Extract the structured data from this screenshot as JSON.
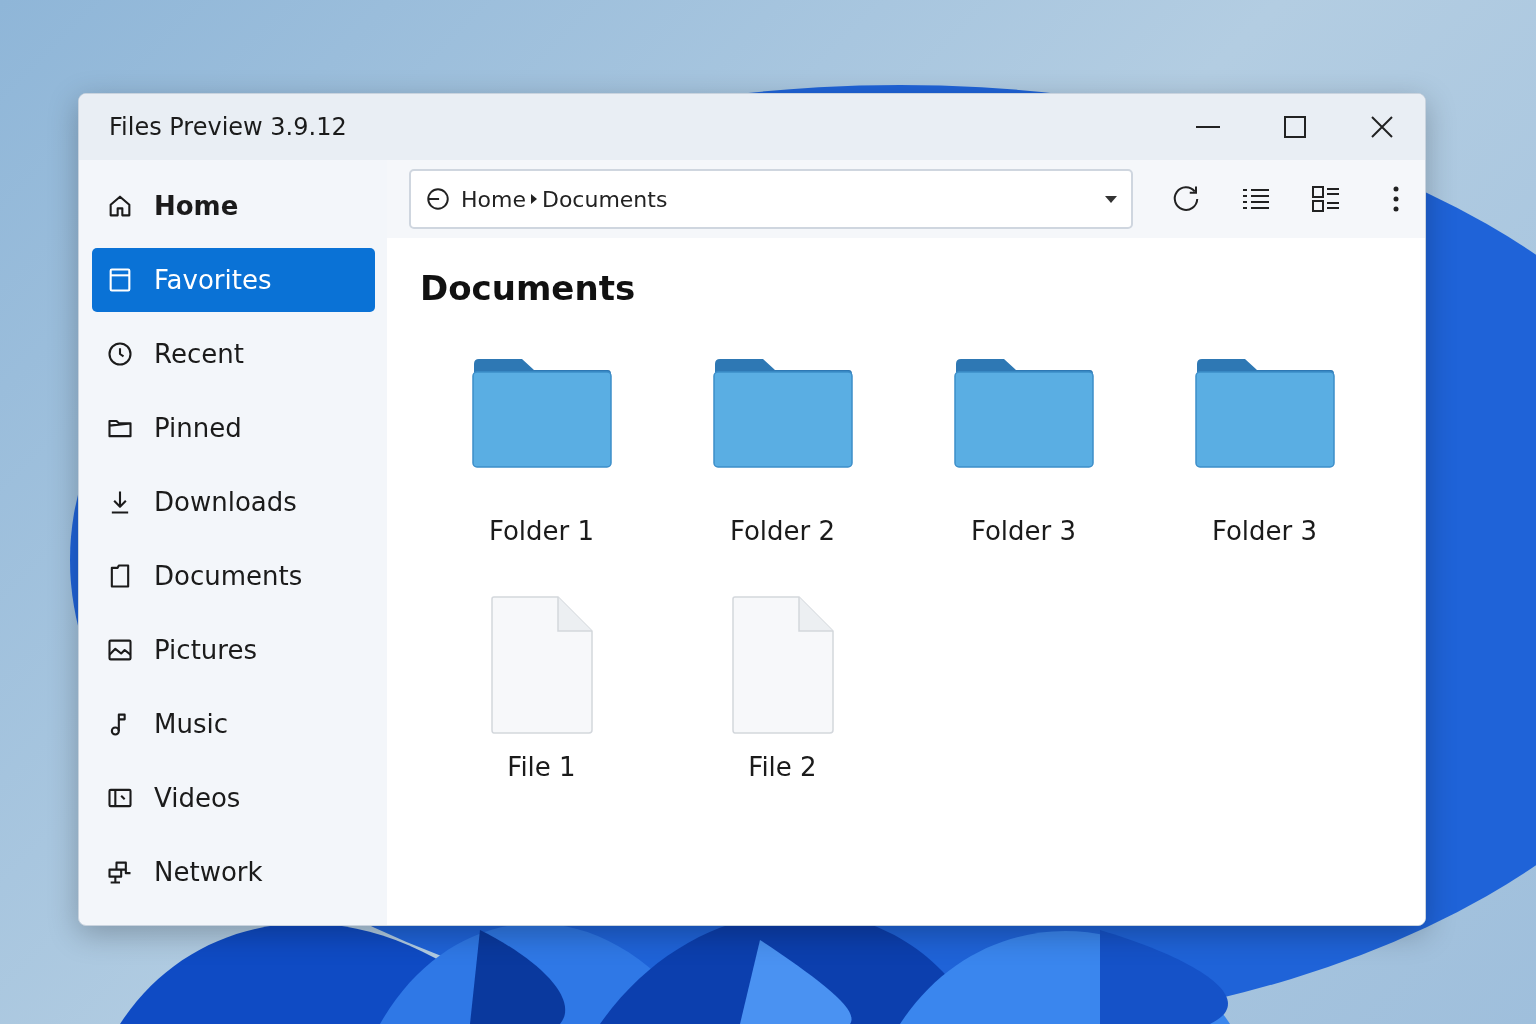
{
  "window": {
    "title": "Files Preview 3.9.12"
  },
  "sidebar": {
    "items": [
      {
        "label": "Home",
        "kind": "home",
        "selected": false
      },
      {
        "label": "Favorites",
        "kind": "favorites",
        "selected": true
      },
      {
        "label": "Recent",
        "kind": "recent",
        "selected": false
      },
      {
        "label": "Pinned",
        "kind": "pinned",
        "selected": false
      },
      {
        "label": "Downloads",
        "kind": "downloads",
        "selected": false
      },
      {
        "label": "Documents",
        "kind": "documents",
        "selected": false
      },
      {
        "label": "Pictures",
        "kind": "pictures",
        "selected": false
      },
      {
        "label": "Music",
        "kind": "music",
        "selected": false
      },
      {
        "label": "Videos",
        "kind": "videos",
        "selected": false
      },
      {
        "label": "Network",
        "kind": "network",
        "selected": false
      }
    ]
  },
  "address_bar": {
    "segments": [
      "Home",
      "Documents"
    ]
  },
  "heading": "Documents",
  "items": [
    {
      "name": "Folder 1",
      "kind": "folder"
    },
    {
      "name": "Folder 2",
      "kind": "folder"
    },
    {
      "name": "Folder 3",
      "kind": "folder"
    },
    {
      "name": "Folder 3",
      "kind": "folder"
    },
    {
      "name": "File 1",
      "kind": "file"
    },
    {
      "name": "File 2",
      "kind": "file"
    }
  ]
}
